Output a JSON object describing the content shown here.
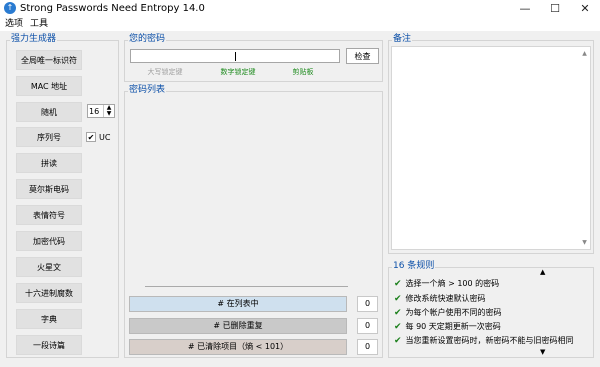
{
  "window": {
    "title": "Strong Passwords Need Entropy 14.0",
    "icon_glyph": "↑",
    "controls": {
      "minimize": "—",
      "maximize": "☐",
      "close": "✕"
    }
  },
  "menu": [
    "选项",
    "工具"
  ],
  "left_panel": {
    "title": "强力生成器",
    "buttons": [
      "全局唯一标识符",
      "MAC 地址",
      "随机",
      "序列号",
      "拼读",
      "莫尔斯电码",
      "表情符号",
      "加密代码",
      "火星文",
      "十六进制腐数",
      "字典",
      "一段诗篇"
    ],
    "random_length": "16",
    "uc_label": "UC",
    "uc_checked": true
  },
  "password_panel": {
    "title": "您的密码",
    "value": "",
    "check_button": "检查",
    "locks": [
      "大写锁定键",
      "数字锁定键",
      "剪贴板"
    ],
    "lock_colors": {
      "off": "#a0a0a0",
      "on": "#1c8a1c"
    }
  },
  "notes_panel": {
    "title": "备注"
  },
  "list_panel": {
    "title": "密码列表",
    "stats": [
      {
        "label": "# 在列表中",
        "count": "0",
        "bg": "#cfe0ee"
      },
      {
        "label": "# 已删除重复",
        "count": "0",
        "bg": "#c9c9c9"
      },
      {
        "label": "# 已清除项目（熵 < 101）",
        "count": "0",
        "bg": "#d8cfca"
      }
    ]
  },
  "rules_panel": {
    "title": "16 条规则",
    "rules": [
      "选择一个熵 > 100 的密码",
      "修改系统快速默认密码",
      "为每个帐户使用不同的密码",
      "每 90 天定期更新一次密码",
      "当您重新设置密码时，新密码不能与旧密码相同"
    ]
  }
}
